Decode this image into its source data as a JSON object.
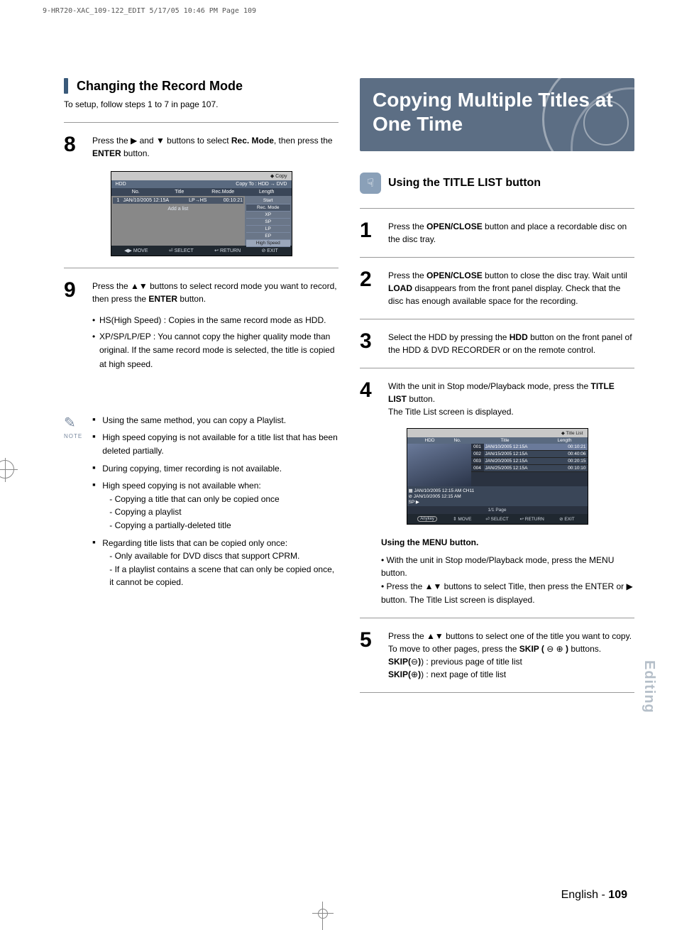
{
  "print_header": "9-HR720-XAC_109-122_EDIT  5/17/05  10:46 PM  Page 109",
  "left": {
    "heading": "Changing the Record Mode",
    "intro": "To setup, follow steps 1 to 7 in page 107.",
    "step8_num": "8",
    "step8_a": "Press the ▶ and ▼ buttons to select ",
    "step8_b": "Rec. Mode",
    "step8_c": ", then press the ",
    "step8_d": "ENTER",
    "step8_e": " button.",
    "step9_num": "9",
    "step9_a": "Press the ▲▼ buttons to select record mode you want to record, then press the ",
    "step9_b": "ENTER",
    "step9_c": " button.",
    "bul1": "HS(High Speed) : Copies in the same record mode as HDD.",
    "bul2": "XP/SP/LP/EP : You cannot copy the higher quality mode than original. If the same record mode is selected, the title is copied at high speed.",
    "note_label": "NOTE",
    "n1": "Using the same method, you can copy a Playlist.",
    "n2": "High speed copying is not available for a title list that has been deleted partially.",
    "n3": "During copying, timer recording is not available.",
    "n4": "High speed copying is not available when:",
    "n4a": "- Copying a title that can only be copied once",
    "n4b": "- Copying a playlist",
    "n4c": "- Copying a partially-deleted title",
    "n5": "Regarding title lists that can be copied only once:",
    "n5a": "- Only available for DVD discs that support CPRM.",
    "n5b": "- If a playlist contains a scene that can only be copied once, it cannot be copied."
  },
  "right": {
    "title": "Copying Multiple Titles at One Time",
    "subhead": "Using the TITLE LIST button",
    "s1n": "1",
    "s1a": "Press the ",
    "s1b": "OPEN/CLOSE",
    "s1c": " button and place a recordable disc on the disc tray.",
    "s2n": "2",
    "s2a": " Press the ",
    "s2b": "OPEN/CLOSE",
    "s2c": " button to close the disc tray. Wait until ",
    "s2d": "LOAD",
    "s2e": " disappears from the front panel display. Check that the disc has enough available space for the recording.",
    "s3n": "3",
    "s3a": "Select the HDD by pressing the ",
    "s3b": "HDD",
    "s3c": " button on the front panel of the HDD & DVD RECORDER or on the remote control.",
    "s4n": "4",
    "s4a": "With the unit in Stop mode/Playback mode, press the ",
    "s4b": "TITLE LIST",
    "s4c": " button.",
    "s4d": "The Title List screen is displayed.",
    "menuhead": "Using the MENU button.",
    "m1": "With the unit in Stop mode/Playback mode, press the ",
    "m1b": "MENU",
    "m1c": " button.",
    "m2": "Press the ▲▼ buttons to select ",
    "m2b": "Title",
    "m2c": ", then press the ",
    "m2d": "ENTER",
    "m2e": " or ▶ button. The Title List screen is displayed.",
    "s5n": "5",
    "s5a": "Press the ▲▼ buttons to select one of the title you want to copy.",
    "s5b": "To move to other pages, press the ",
    "s5c": "SKIP (",
    "s5d": " )",
    "s5e": " buttons.",
    "s5f": "SKIP(",
    "s5g": ") : previous page of title list",
    "s5h": "SKIP(",
    "s5i": ") : next page of title list"
  },
  "sidetab": "Editing",
  "footer_l": "English - ",
  "footer_n": "109",
  "osd1": {
    "copy": "◆   Copy",
    "hdd": "HDD",
    "ct": "Copy To : HDD → DVD",
    "c_no": "No.",
    "c_title": "Title",
    "c_rm": "Rec.Mode",
    "c_len": "Length",
    "r_no": "1",
    "r_t": "JAN/10/2005 12:15A",
    "r_rm": "LP→HS",
    "r_len": "00:10:21",
    "add": "Add a list",
    "m_start": "Start",
    "m_rm": "Rec. Mode",
    "xp": "XP",
    "sp": "SP",
    "lp": "LP",
    "ep": "EP",
    "hs": "High Speed",
    "move": "◀▶ MOVE",
    "sel": "⏎ SELECT",
    "ret": "↩ RETURN",
    "exit": "⊘ EXIT"
  },
  "osd2": {
    "tl": "◆   Title List",
    "hdd": "HDD",
    "no": "No.",
    "title": "Title",
    "len": "Length",
    "rows": [
      {
        "n": "001",
        "t": "JAN/10/2005 12:15A",
        "l": "00:10:21"
      },
      {
        "n": "002",
        "t": "JAN/15/2005 12:15A",
        "l": "00:40:06"
      },
      {
        "n": "003",
        "t": "JAN/20/2005 12:15A",
        "l": "00:20:15"
      },
      {
        "n": "004",
        "t": "JAN/25/2005 12:15A",
        "l": "00:10:10"
      }
    ],
    "meta1": "JAN/10/2005 12:15 AM CH11",
    "meta2": "JAN/10/2005 12:15 AM",
    "sp": "SP ▶",
    "page": "1/1  Page",
    "anykey": "Anykey",
    "move": "⇕ MOVE",
    "sel": "⏎ SELECT",
    "ret": "↩ RETURN",
    "exit": "⊘ EXIT"
  }
}
